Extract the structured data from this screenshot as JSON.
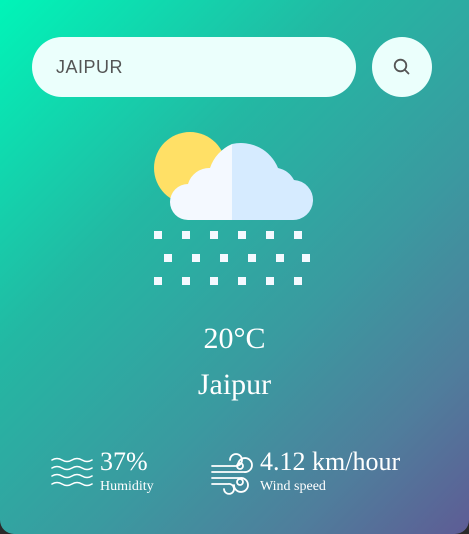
{
  "search": {
    "value": "JAIPUR",
    "icon": "search-icon"
  },
  "weather": {
    "icon": "snow-cloud-sun-icon",
    "temperature": "20°C",
    "city": "Jaipur"
  },
  "humidity": {
    "icon": "humidity-waves-icon",
    "value": "37%",
    "label": "Humidity"
  },
  "wind": {
    "icon": "wind-icon",
    "value": "4.12 km/hour",
    "label": "Wind speed"
  },
  "colors": {
    "gradient_start": "#00f5b8",
    "gradient_end": "#5e5c95",
    "sun": "#ffe066",
    "cloud_light": "#f4f9ff",
    "cloud_shade": "#d6ebff",
    "input_bg": "#ebfffc"
  }
}
